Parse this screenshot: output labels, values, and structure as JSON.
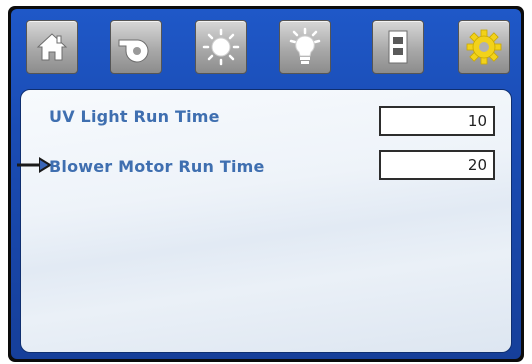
{
  "toolbar": {
    "buttons": [
      {
        "icon": "home-icon"
      },
      {
        "icon": "blower-icon"
      },
      {
        "icon": "uv-light-icon"
      },
      {
        "icon": "lightbulb-icon"
      },
      {
        "icon": "door-icon"
      },
      {
        "icon": "gear-icon",
        "accent": "#f2d21a"
      }
    ]
  },
  "settings": {
    "rows": [
      {
        "label": "UV Light Run Time",
        "value": "10"
      },
      {
        "label": "Blower Motor Run Time",
        "value": "20",
        "selected": true
      }
    ]
  },
  "colors": {
    "frame_blue": "#1f58c8",
    "label_blue": "#3f6fb0",
    "gear_yellow": "#f2d21a"
  }
}
